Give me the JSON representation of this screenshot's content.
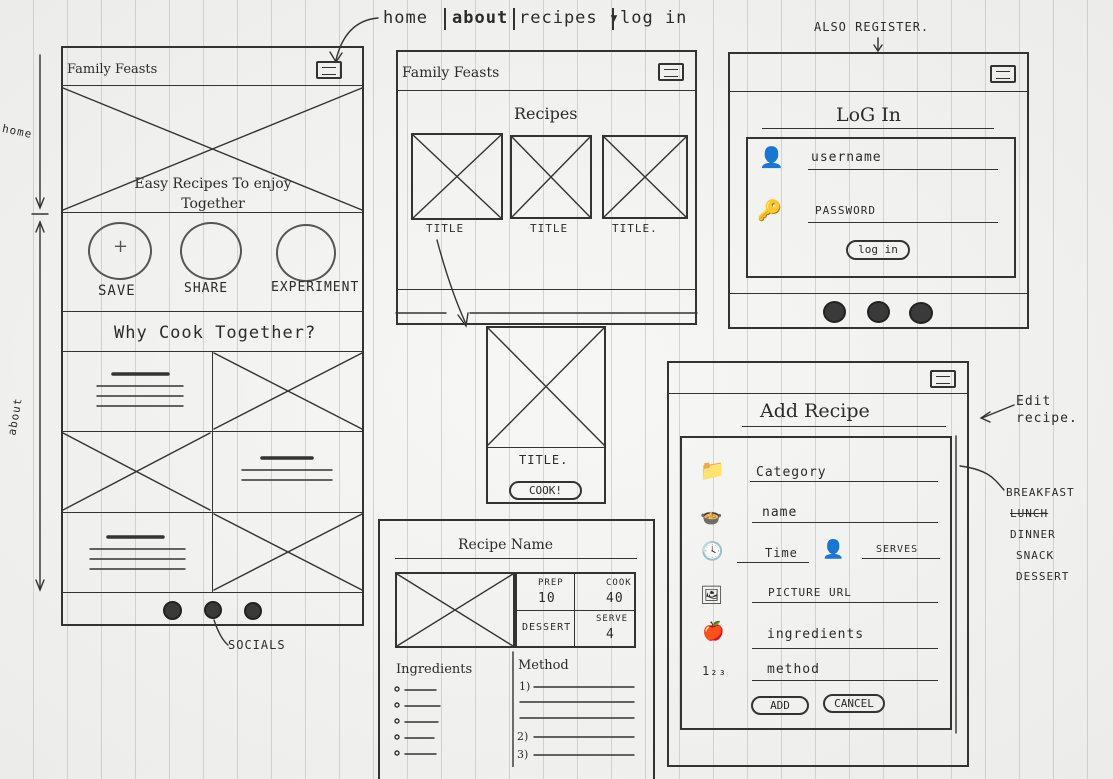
{
  "nav": {
    "home": "home",
    "about": "about",
    "recipes": "recipes ▾",
    "login": "log in"
  },
  "side": {
    "home": "home",
    "about": "about"
  },
  "brand": "Family Feasts",
  "home_screen": {
    "hero_text": "Easy Recipes To enjoy Together",
    "features": [
      "SAVE",
      "SHARE",
      "EXPERIMENT"
    ],
    "why_heading": "Why Cook Together?",
    "footer_note": "SOCIALS"
  },
  "recipes_screen": {
    "heading": "Recipes",
    "card_titles": [
      "TITLE",
      "TITLE",
      "TITLE."
    ]
  },
  "detail_card": {
    "title": "TITLE.",
    "button": "COOK!"
  },
  "login_screen": {
    "note": "ALSO REGISTER.",
    "heading": "LoG In",
    "username_label": "username",
    "password_label": "PASSWORD",
    "button": "log in"
  },
  "add_recipe": {
    "heading": "Add Recipe",
    "edit_note": "Edit recipe.",
    "fields": {
      "category": "Category",
      "name": "name",
      "time": "Time",
      "serves": "SERVES",
      "picture": "PICTURE URL",
      "ingredients": "ingredients",
      "method": "method"
    },
    "method_icon": "1₂₃",
    "add_button": "ADD",
    "cancel_button": "CANCEL",
    "category_options": [
      "BREAKFAST",
      "LUNCH",
      "DINNER",
      "SNACK",
      "DESSERT"
    ]
  },
  "recipe_detail": {
    "heading": "Recipe Name",
    "prep_label": "PREP",
    "prep_value": "10",
    "cook_label": "COOK",
    "cook_value": "40",
    "category": "DESSERT",
    "serve_label": "SERVE",
    "serve_value": "4",
    "ingredients_label": "Ingredients",
    "method_label": "Method",
    "method_steps": [
      "1)",
      "2)",
      "3)"
    ]
  }
}
